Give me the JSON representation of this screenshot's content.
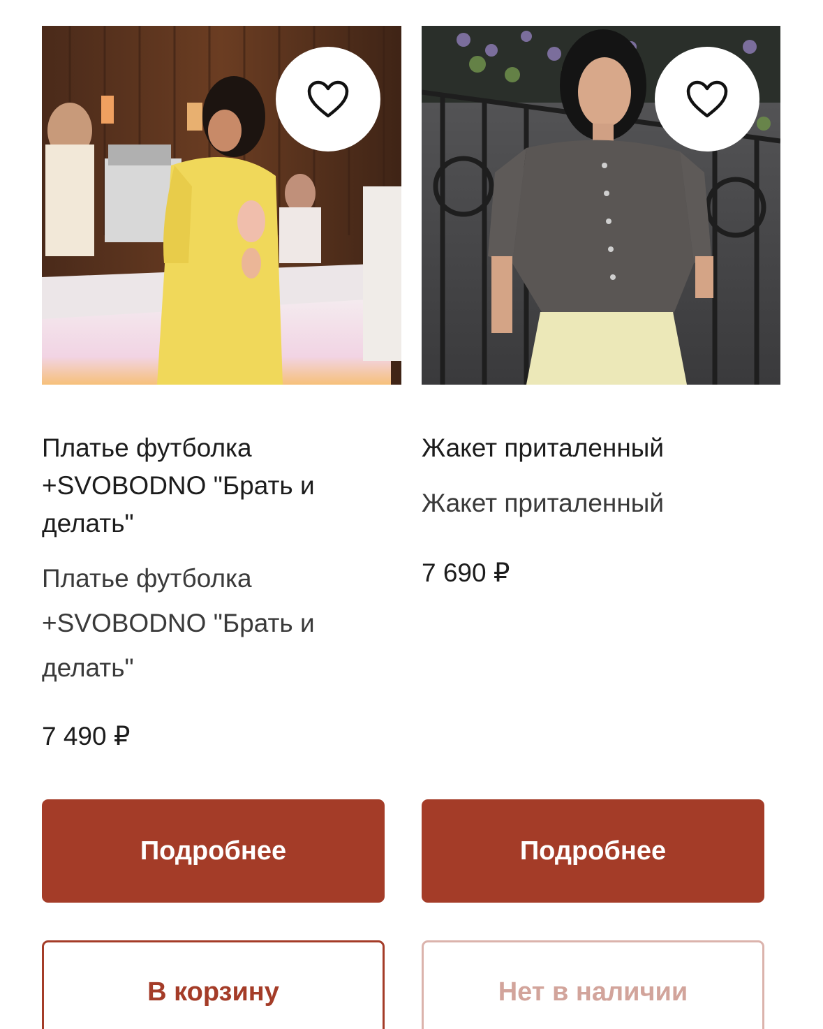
{
  "products": [
    {
      "title": "Платье футболка +SVOBODNO \"Брать и делать\"",
      "subtitle": "Платье футболка +SVOBODNO \"Брать и делать\"",
      "price": "7 490 ₽",
      "primary_button": "Подробнее",
      "secondary_button": "В корзину",
      "favorite_icon": "heart-outline-icon"
    },
    {
      "title": "Жакет приталенный",
      "subtitle": "Жакет приталенный",
      "price": "7 690 ₽",
      "primary_button": "Подробнее",
      "secondary_button": "Нет в наличии",
      "favorite_icon": "heart-outline-icon"
    }
  ],
  "colors": {
    "accent": "#a43c28",
    "disabled_text": "#d2a49b",
    "disabled_border": "#dbb3ac"
  }
}
